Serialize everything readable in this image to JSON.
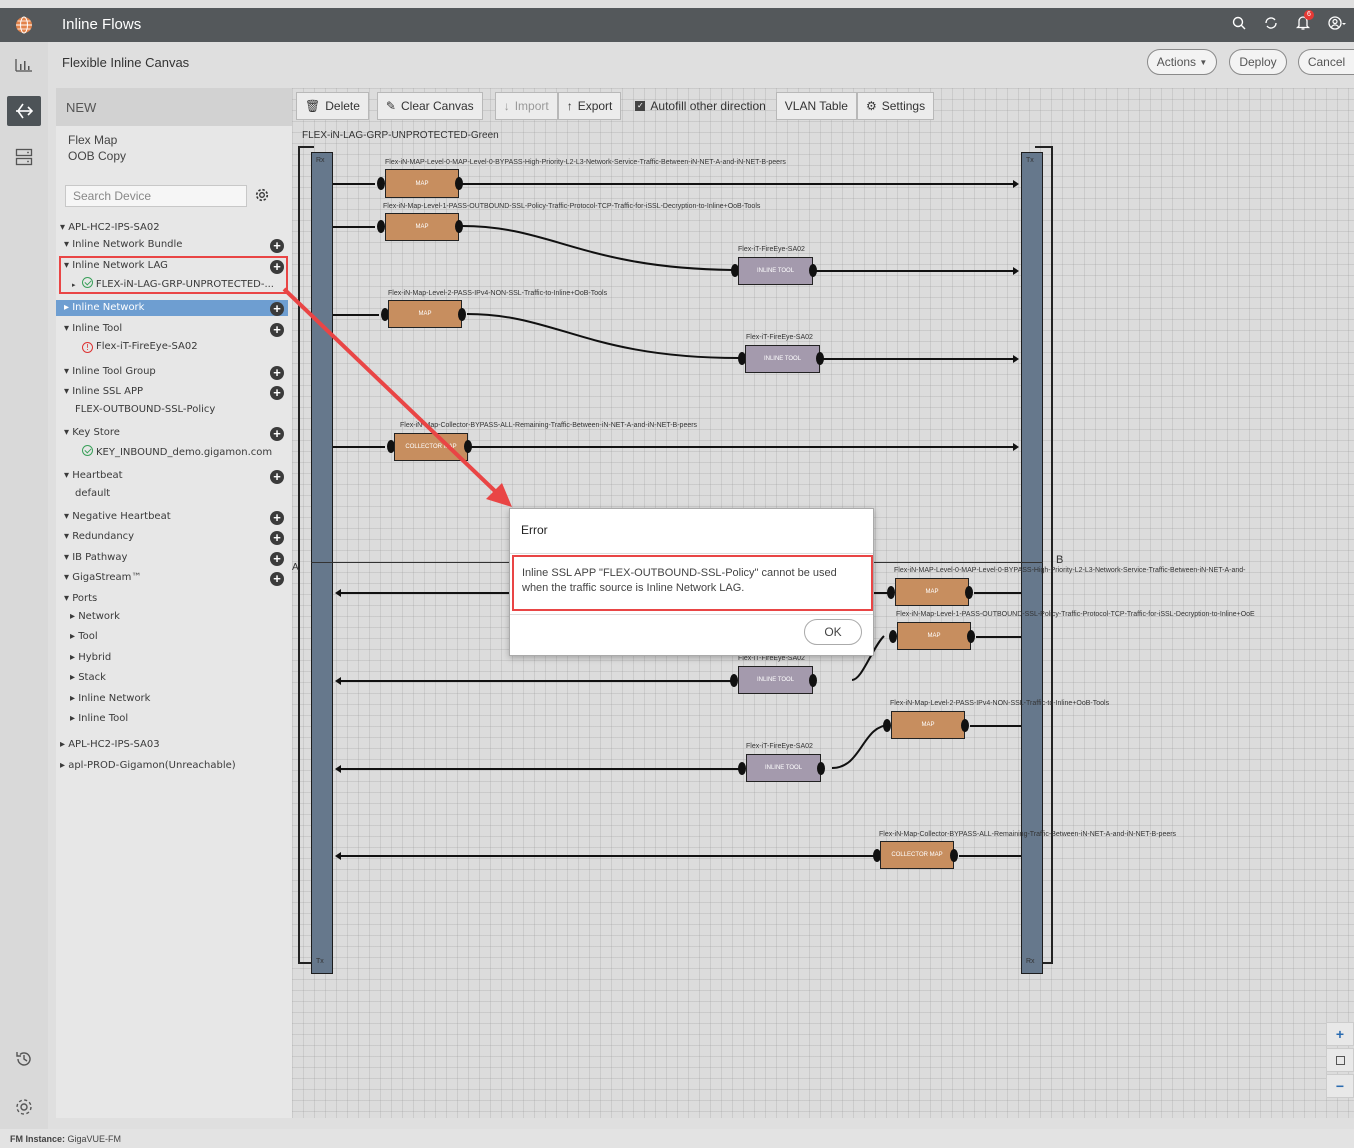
{
  "header": {
    "title": "Inline Flows",
    "notif_count": "6"
  },
  "subheader": {
    "title": "Flexible Inline Canvas",
    "actions": "Actions",
    "deploy": "Deploy",
    "cancel": "Cancel"
  },
  "panel": {
    "new_label": "NEW",
    "flex_map": "Flex Map",
    "oob_copy": "OOB Copy",
    "search_placeholder": "Search Device",
    "tree": {
      "apl_hc2_ips_sa02": "▾ APL-HC2-IPS-SA02",
      "inline_network_bundle": "▾ Inline Network Bundle",
      "inline_network_lag": "▾ Inline Network LAG",
      "lag_item": "FLEX-iN-LAG-GRP-UNPROTECTED-...",
      "inline_network": "▸ Inline Network",
      "inline_tool": "▾ Inline Tool",
      "tool_item": "Flex-iT-FireEye-SA02",
      "inline_tool_group": "▾ Inline Tool Group",
      "inline_ssl_app": "▾ Inline SSL APP",
      "ssl_item": "FLEX-OUTBOUND-SSL-Policy",
      "key_store": "▾ Key Store",
      "key_item": "KEY_INBOUND_demo.gigamon.com",
      "heartbeat": "▾ Heartbeat",
      "heartbeat_item": "default",
      "negative_heartbeat": "▾ Negative Heartbeat",
      "redundancy": "▾ Redundancy",
      "ib_pathway": "▾ IB Pathway",
      "gigastream": "▾ GigaStream™",
      "ports": "▾ Ports",
      "network": "▸ Network",
      "tool": "▸ Tool",
      "hybrid": "▸ Hybrid",
      "stack": "▸ Stack",
      "ports_inline_network": "▸ Inline Network",
      "ports_inline_tool": "▸ Inline Tool",
      "apl_hc2_ips_sa03": "▸ APL-HC2-IPS-SA03",
      "apl_prod": "▸ apl-PROD-Gigamon(Unreachable)"
    }
  },
  "toolbar": {
    "delete": "Delete",
    "clear_canvas": "Clear Canvas",
    "import": "Import",
    "export": "Export",
    "autofill": "Autofill other direction",
    "vlan_table": "VLAN Table",
    "settings": "Settings"
  },
  "canvas": {
    "title": "FLEX-iN-LAG-GRP-UNPROTECTED-Green",
    "rx": "Rx",
    "tx": "Tx",
    "label_a": "A",
    "label_b": "B",
    "map_label": "MAP",
    "inline_tool_label": "INLINE TOOL",
    "collector_map_label": "COLLECTOR MAP",
    "flow1": "Flex-iN-MAP-Level-0-MAP-Level-0-BYPASS-High-Priority-L2-L3-Network-Service-Traffic-Between-iN-NET-A-and-iN-NET-B-peers",
    "flow2": "Flex-iN-Map-Level-1-PASS-OUTBOUND-SSL-Policy-Traffic-Protocol-TCP-Traffic-for-iSSL-Decryption-to-Inline+OoB-Tools",
    "flow3": "Flex-iN-Map-Level-2-PASS-IPv4-NON-SSL-Traffic-to-Inline+OoB-Tools",
    "flow4": "Flex-iN-Map-Collector-BYPASS-ALL-Remaining-Traffic-Between-iN-NET-A-and-iN-NET-B-peers",
    "tool_name": "Flex-iT-FireEye-SA02",
    "flow1_short": "Flex-iN-MAP-Level-0-MAP-Level-0-BYPASS-High-Priority-L2-L3-Network-Service-Traffic-Between-iN-NET-A-and-",
    "flow2_short": "Flex-iN-Map-Level-1-PASS-OUTBOUND-SSL-Policy-Traffic-Protocol-TCP-Traffic-for-iSSL-Decryption-to-Inline+OoE"
  },
  "dialog": {
    "title": "Error",
    "message": "Inline SSL APP \"FLEX-OUTBOUND-SSL-Policy\" cannot be used when the traffic source is Inline Network LAG.",
    "ok": "OK"
  },
  "footer": {
    "label": "FM Instance:",
    "value": "GigaVUE-FM"
  },
  "colors": {
    "topbar": "#54585b",
    "highlight": "#6e9ed1",
    "callout": "#e94545",
    "map": "#c78e5f",
    "inline_tool": "#a49aad"
  }
}
